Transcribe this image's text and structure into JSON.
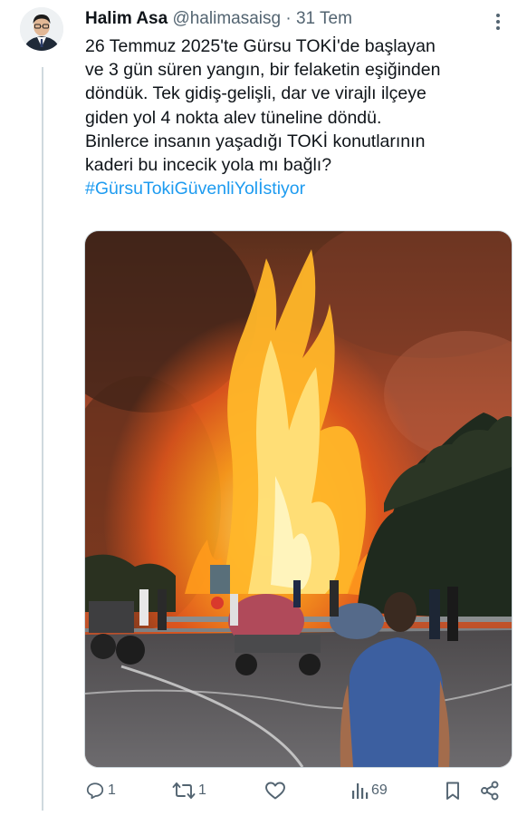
{
  "tweet": {
    "author_name": "Halim Asa",
    "handle": "@halimasaisg",
    "separator": "·",
    "date": "31 Tem",
    "text_lines": [
      "26 Temmuz 2025'te Gürsu TOKİ'de başlayan",
      "ve 3 gün süren yangın, bir felaketin eşiğinden",
      "döndük. Tek gidiş-gelişli, dar ve virajlı ilçeye",
      "giden yol 4 nokta alev tüneline döndü.",
      "Binlerce insanın yaşadığı TOKİ konutlarının",
      "kaderi bu incecik yola mı bağlı?"
    ],
    "hashtag": "#GürsuTokiGüvenliYolİstiyor",
    "media_description": "wildfire-photo"
  },
  "actions": {
    "reply_count": "1",
    "retweet_count": "1",
    "like_count": "",
    "views_count": "69"
  },
  "icons": {
    "more": "more-vertical-icon",
    "reply": "reply-icon",
    "retweet": "retweet-icon",
    "like": "heart-icon",
    "views": "analytics-icon",
    "bookmark": "bookmark-icon",
    "share": "share-icon"
  },
  "colors": {
    "text": "#0f1419",
    "secondary": "#536471",
    "hashtag": "#1d9bf0",
    "thread_line": "#cfd9de"
  }
}
